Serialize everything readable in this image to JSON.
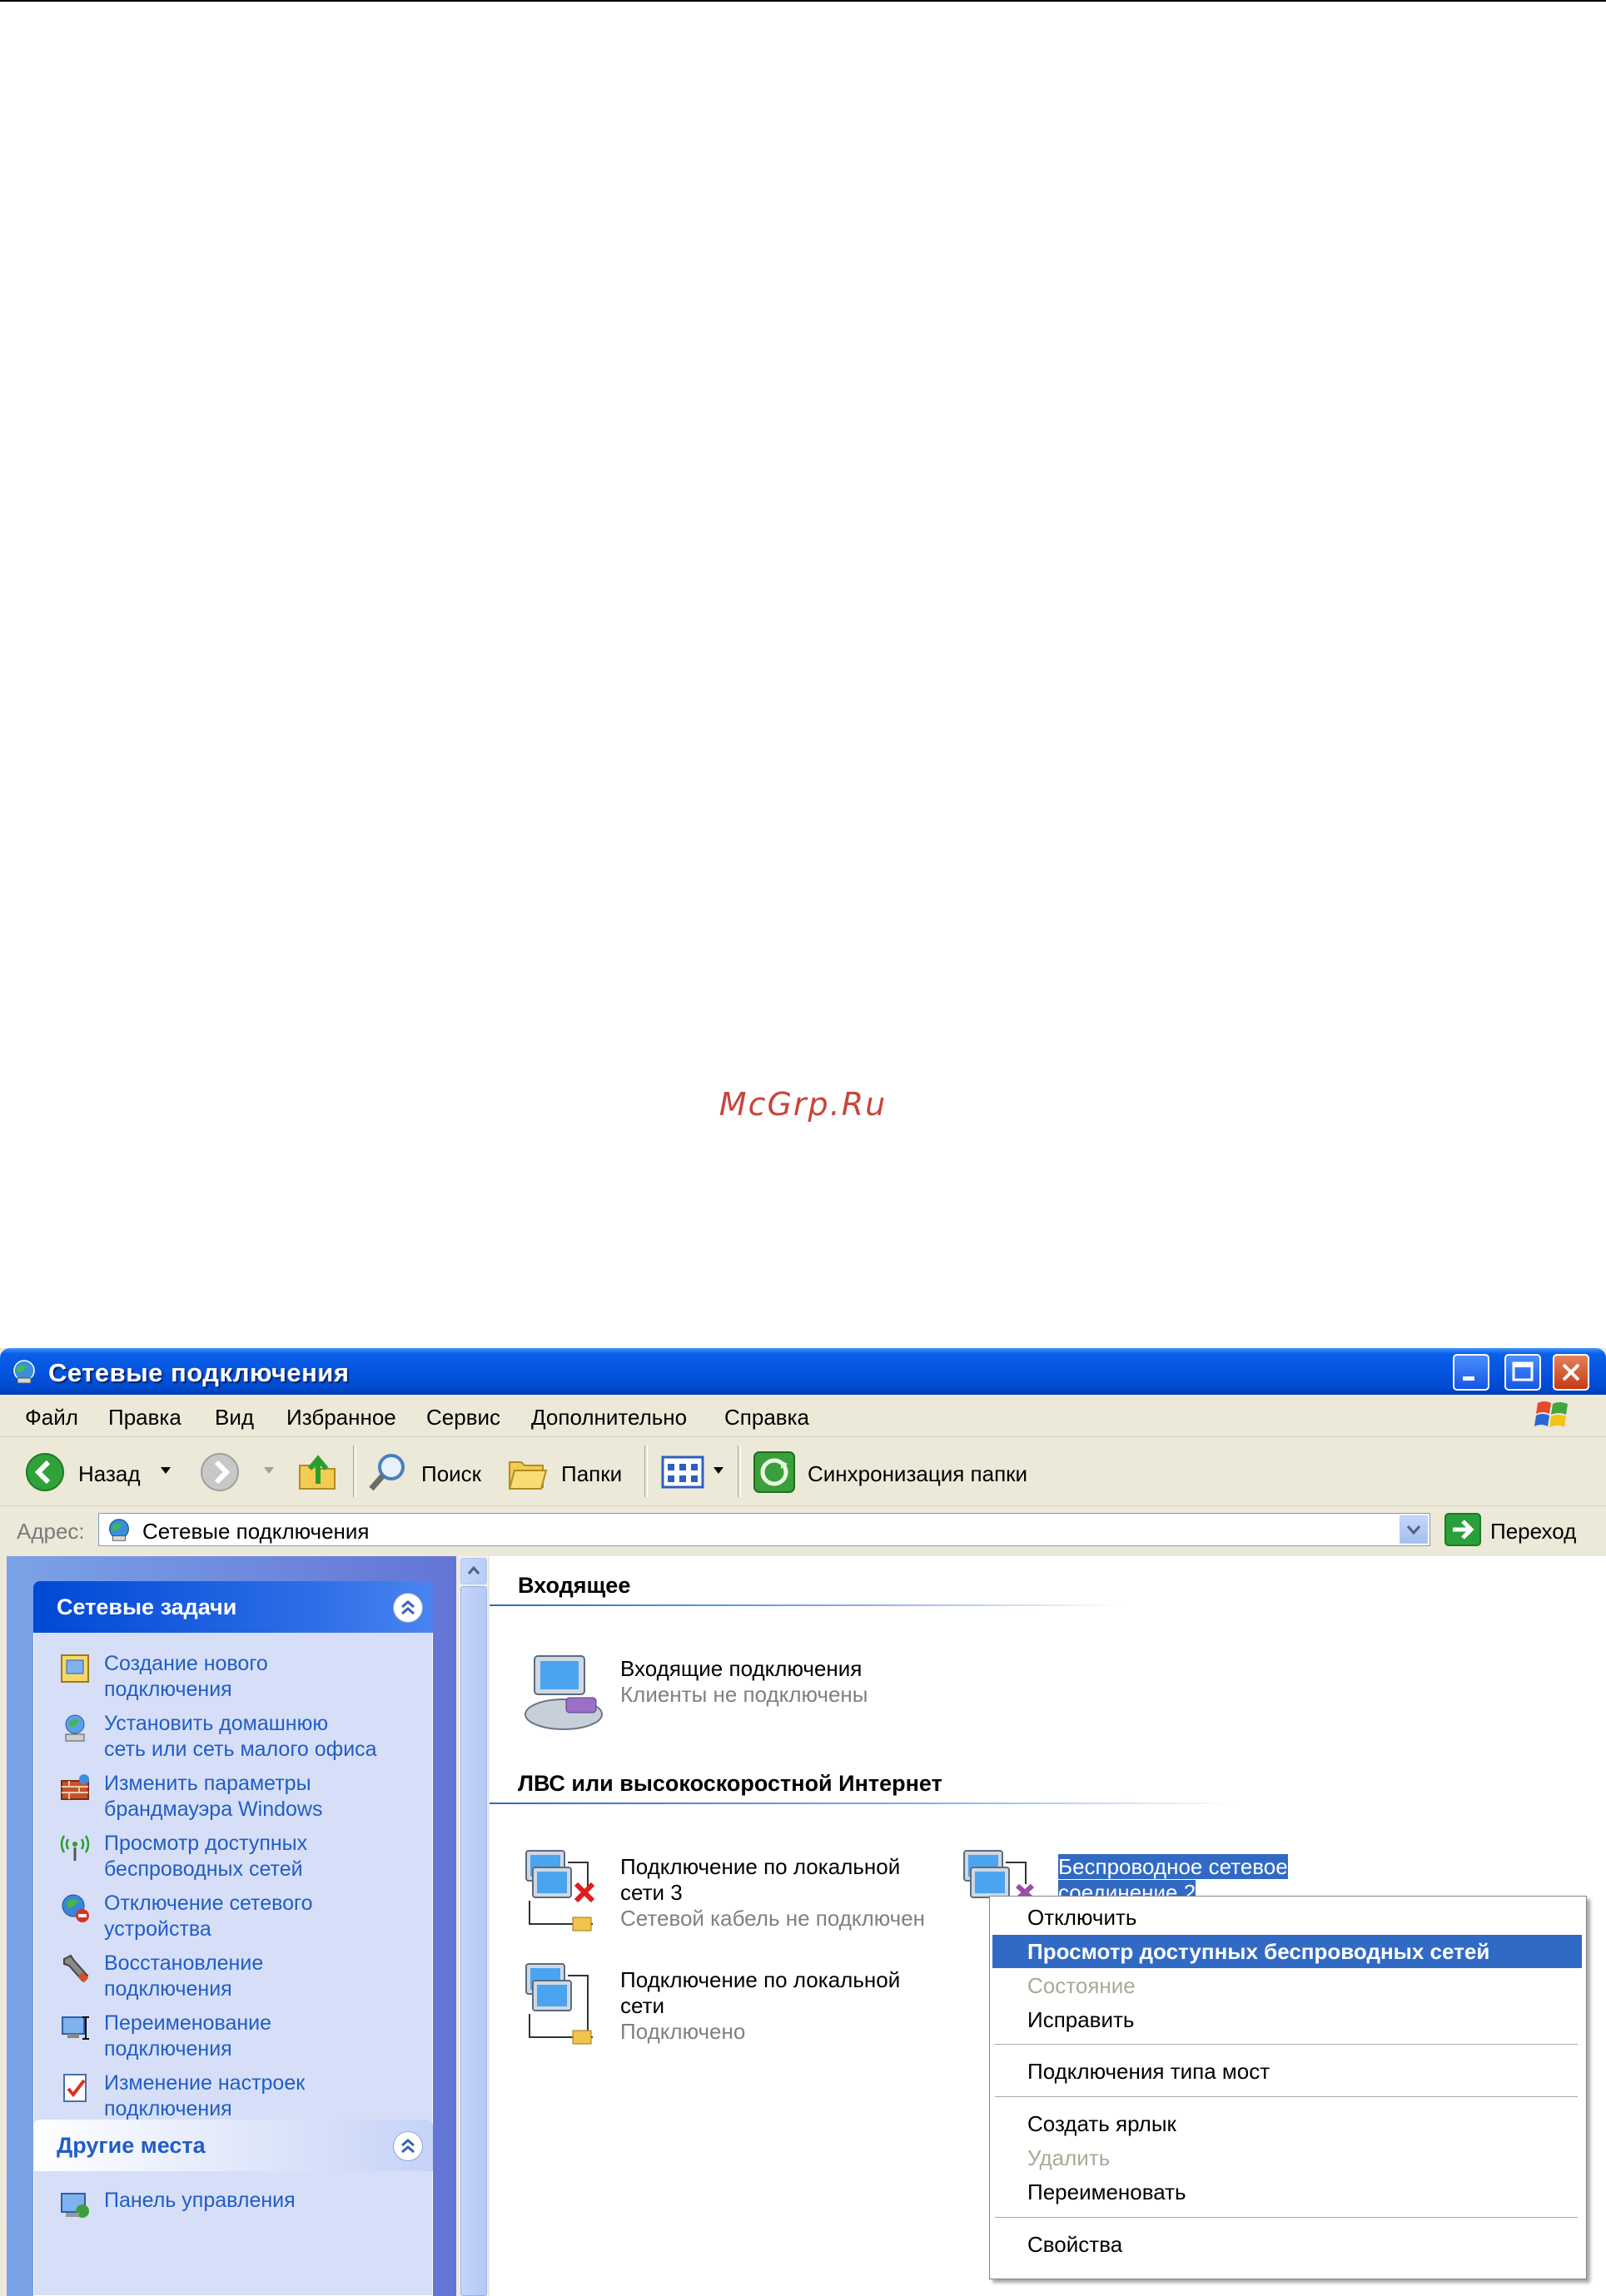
{
  "watermark": "McGrp.Ru",
  "window": {
    "title": "Сетевые подключения",
    "menu": [
      "Файл",
      "Правка",
      "Вид",
      "Избранное",
      "Сервис",
      "Дополнительно",
      "Справка"
    ],
    "toolbar": {
      "back": "Назад",
      "search": "Поиск",
      "folders": "Папки",
      "sync": "Синхронизация папки"
    },
    "address": {
      "label": "Адрес:",
      "value": "Сетевые подключения",
      "go": "Переход"
    }
  },
  "sidebar": {
    "network_tasks": {
      "title": "Сетевые задачи",
      "items": [
        {
          "label": "Создание нового\nподключения",
          "icon": "new-connection-icon"
        },
        {
          "label": "Установить домашнюю\nсеть или сеть малого офиса",
          "icon": "home-network-icon"
        },
        {
          "label": "Изменить параметры\nбрандмауэра Windows",
          "icon": "firewall-icon"
        },
        {
          "label": "Просмотр доступных\nбеспроводных сетей",
          "icon": "wireless-icon"
        },
        {
          "label": "Отключение сетевого\nустройства",
          "icon": "disable-device-icon"
        },
        {
          "label": "Восстановление\nподключения",
          "icon": "repair-icon"
        },
        {
          "label": "Переименование\nподключения",
          "icon": "rename-icon"
        },
        {
          "label": "Изменение настроек\nподключения",
          "icon": "settings-icon"
        }
      ]
    },
    "other_places": {
      "title": "Другие места",
      "items": [
        {
          "label": "Панель управления",
          "icon": "control-panel-icon"
        }
      ]
    }
  },
  "main": {
    "incoming": {
      "header": "Входящее",
      "items": [
        {
          "name": "Входящие подключения",
          "status": "Клиенты не подключены"
        }
      ]
    },
    "lan": {
      "header": "ЛВС или высокоскоростной Интернет",
      "items": [
        {
          "name": "Подключение по локальной\nсети 3",
          "status": "Сетевой кабель не подключен"
        },
        {
          "name": "Беспроводное сетевое\nсоединение 2",
          "status": ""
        },
        {
          "name": "Подключение по локальной\nсети",
          "status": "Подключено"
        }
      ]
    }
  },
  "context_menu": {
    "items": [
      {
        "label": "Отключить",
        "state": "normal"
      },
      {
        "label": "Просмотр доступных беспроводных сетей",
        "state": "highlight"
      },
      {
        "label": "Состояние",
        "state": "disabled"
      },
      {
        "label": "Исправить",
        "state": "normal"
      },
      {
        "label": "Подключения типа мост",
        "state": "normal"
      },
      {
        "label": "Создать ярлык",
        "state": "normal"
      },
      {
        "label": "Удалить",
        "state": "disabled"
      },
      {
        "label": "Переименовать",
        "state": "normal"
      },
      {
        "label": "Свойства",
        "state": "normal"
      }
    ]
  },
  "colors": {
    "titlebar": "#0554e0",
    "selection": "#316ac5",
    "link": "#215dc6",
    "watermark": "#c8453c"
  }
}
